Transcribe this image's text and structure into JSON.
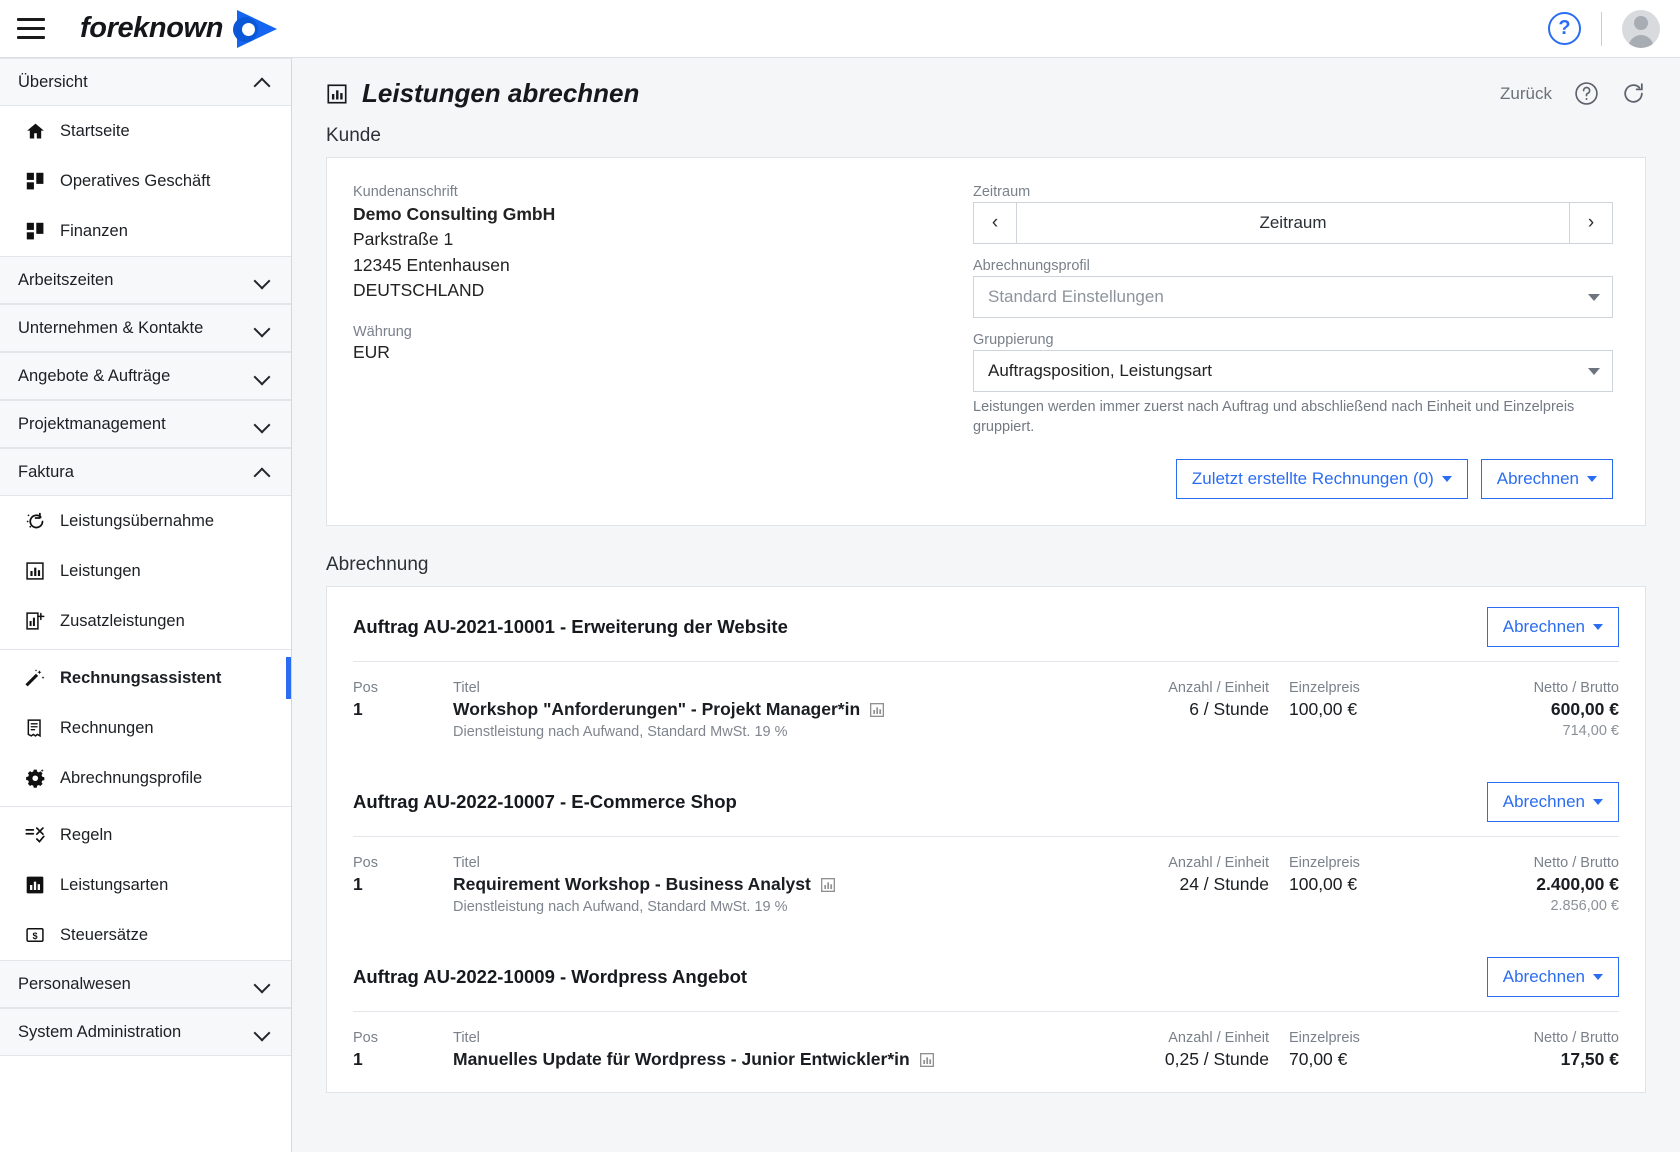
{
  "topbar": {
    "brand": "foreknown",
    "menu_icon": "hamburger-icon",
    "help_icon": "help-circle-icon",
    "avatar_icon": "user-avatar-icon"
  },
  "sidebar": {
    "groups": [
      {
        "label": "Übersicht",
        "expanded": true,
        "items": [
          {
            "label": "Startseite",
            "icon": "home-icon"
          },
          {
            "label": "Operatives Geschäft",
            "icon": "grid-icon"
          },
          {
            "label": "Finanzen",
            "icon": "grid-icon"
          }
        ]
      },
      {
        "label": "Arbeitszeiten",
        "expanded": false,
        "items": []
      },
      {
        "label": "Unternehmen & Kontakte",
        "expanded": false,
        "items": []
      },
      {
        "label": "Angebote & Aufträge",
        "expanded": false,
        "items": []
      },
      {
        "label": "Projektmanagement",
        "expanded": false,
        "items": []
      },
      {
        "label": "Faktura",
        "expanded": true,
        "items": [
          {
            "label": "Leistungsübernahme",
            "icon": "transfer-icon",
            "active": false
          },
          {
            "label": "Leistungen",
            "icon": "bar-chart-icon",
            "active": false
          },
          {
            "label": "Zusatzleistungen",
            "icon": "bar-chart-plus-icon",
            "active": false
          },
          {
            "label": "Rechnungsassistent",
            "icon": "magic-wand-icon",
            "active": true,
            "separator_before": true
          },
          {
            "label": "Rechnungen",
            "icon": "invoice-icon",
            "active": false
          },
          {
            "label": "Abrechnungsprofile",
            "icon": "gear-sparkle-icon",
            "active": false
          },
          {
            "label": "Regeln",
            "icon": "rules-icon",
            "active": false,
            "separator_before": true
          },
          {
            "label": "Leistungsarten",
            "icon": "bar-chart-filled-icon",
            "active": false
          },
          {
            "label": "Steuersätze",
            "icon": "money-icon",
            "active": false
          }
        ]
      },
      {
        "label": "Personalwesen",
        "expanded": false,
        "items": []
      },
      {
        "label": "System Administration",
        "expanded": false,
        "items": []
      }
    ]
  },
  "page": {
    "title": "Leistungen abrechnen",
    "title_icon": "bar-chart-icon",
    "back_label": "Zurück",
    "help_icon": "help-circle-icon",
    "refresh_icon": "refresh-icon"
  },
  "kunde": {
    "section_label": "Kunde",
    "address_label": "Kundenanschrift",
    "company": "Demo Consulting GmbH",
    "street": "Parkstraße 1",
    "city": "12345 Entenhausen",
    "country": "DEUTSCHLAND",
    "currency_label": "Währung",
    "currency_value": "EUR",
    "zeitraum_label": "Zeitraum",
    "zeitraum_value": "Zeitraum",
    "zeitraum_prev_icon": "chevron-left-icon",
    "zeitraum_next_icon": "chevron-right-icon",
    "profil_label": "Abrechnungsprofil",
    "profil_placeholder": "Standard Einstellungen",
    "gruppierung_label": "Gruppierung",
    "gruppierung_value": "Auftragsposition, Leistungsart",
    "gruppierung_hint": "Leistungen werden immer zuerst nach Auftrag und abschließend nach Einheit und Einzelpreis gruppiert.",
    "recent_invoices_button": "Zuletzt erstellte Rechnungen (0)",
    "abrechnen_button": "Abrechnen"
  },
  "abrechnung": {
    "section_label": "Abrechnung",
    "columns": {
      "pos": "Pos",
      "titel": "Titel",
      "qty": "Anzahl / Einheit",
      "price": "Einzelpreis",
      "net": "Netto / Brutto"
    },
    "orders": [
      {
        "title": "Auftrag AU-2021-10001 - Erweiterung der Website",
        "button": "Abrechnen",
        "rows": [
          {
            "pos": "1",
            "titel": "Workshop \"Anforderungen\" - Projekt Manager*in",
            "titel_icon": "bar-chart-icon",
            "subtitle": "Dienstleistung nach Aufwand, Standard MwSt. 19 %",
            "qty": "6 / Stunde",
            "price": "100,00 €",
            "net": "600,00 €",
            "gross": "714,00 €"
          }
        ]
      },
      {
        "title": "Auftrag AU-2022-10007 - E-Commerce Shop",
        "button": "Abrechnen",
        "rows": [
          {
            "pos": "1",
            "titel": "Requirement Workshop - Business Analyst",
            "titel_icon": "bar-chart-icon",
            "subtitle": "Dienstleistung nach Aufwand, Standard MwSt. 19 %",
            "qty": "24 / Stunde",
            "price": "100,00 €",
            "net": "2.400,00 €",
            "gross": "2.856,00 €"
          }
        ]
      },
      {
        "title": "Auftrag AU-2022-10009 - Wordpress Angebot",
        "button": "Abrechnen",
        "rows": [
          {
            "pos": "1",
            "titel": "Manuelles Update für Wordpress - Junior Entwickler*in",
            "titel_icon": "bar-chart-icon",
            "subtitle": "",
            "qty": "0,25 / Stunde",
            "price": "70,00 €",
            "net": "17,50 €",
            "gross": ""
          }
        ]
      }
    ]
  },
  "colors": {
    "accent": "#2b6df2",
    "page_bg": "#f5f6f8",
    "muted": "#7a818b"
  }
}
